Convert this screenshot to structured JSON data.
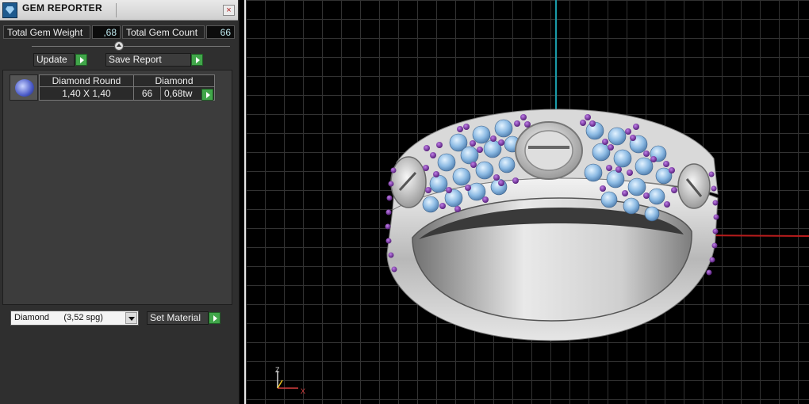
{
  "window": {
    "title": "GEM REPORTER",
    "close_label": "×"
  },
  "stats": {
    "total_weight_label": "Total Gem Weight",
    "total_weight_value": ",68",
    "total_count_label": "Total Gem Count",
    "total_count_value": "66"
  },
  "actions": {
    "update_label": "Update",
    "save_report_label": "Save Report",
    "set_material_label": "Set Material"
  },
  "gem_table": {
    "columns": [
      "Diamond Round",
      "Diamond"
    ],
    "rows": [
      {
        "size": "1,40 X 1,40",
        "count": "66",
        "weight": "0,68tw"
      }
    ]
  },
  "material": {
    "selected": "Diamond      (3,52 spg)"
  },
  "viewport": {
    "axis_z": "Z",
    "axis_x": "X"
  },
  "colors": {
    "panel_bg": "#2f2f2f",
    "action_green": "#41a64a",
    "metal": "#c8c8c8",
    "stone_blue": "#9fc8ec",
    "stone_purple": "#7a2aa6",
    "axis_red": "#b81c1c",
    "axis_cyan": "#1a9aa8"
  },
  "icons": {
    "app": "gem-reporter-icon",
    "close": "close-icon",
    "play": "play-arrow-icon",
    "dropdown": "chevron-down-icon"
  }
}
